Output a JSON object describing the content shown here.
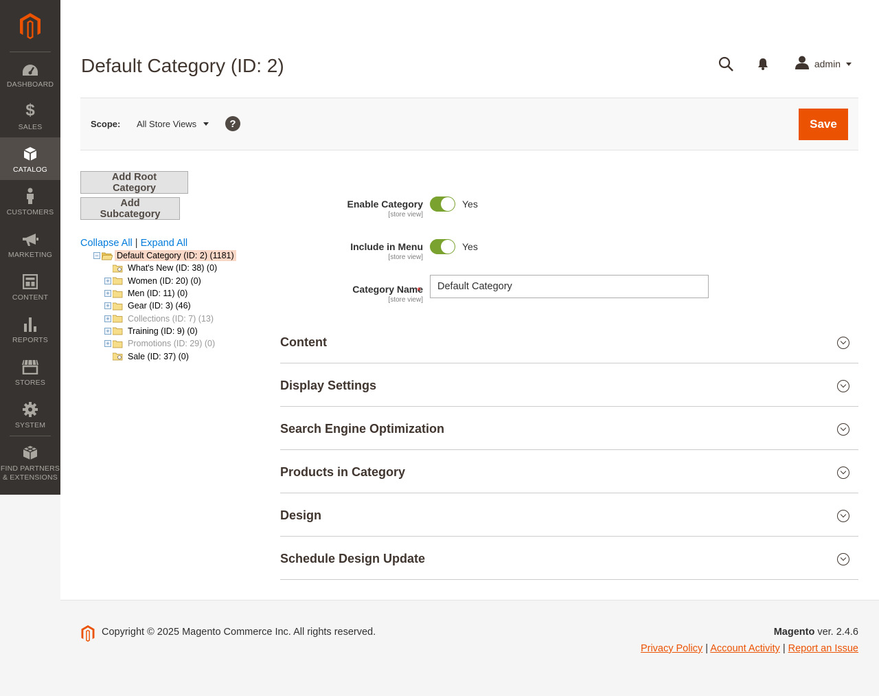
{
  "sidebar": {
    "items": [
      {
        "label": "DASHBOARD",
        "icon": "dashboard-icon"
      },
      {
        "label": "SALES",
        "icon": "dollar-icon"
      },
      {
        "label": "CATALOG",
        "icon": "box-icon",
        "active": true
      },
      {
        "label": "CUSTOMERS",
        "icon": "person-icon"
      },
      {
        "label": "MARKETING",
        "icon": "megaphone-icon"
      },
      {
        "label": "CONTENT",
        "icon": "layout-icon"
      },
      {
        "label": "REPORTS",
        "icon": "bar-chart-icon"
      },
      {
        "label": "STORES",
        "icon": "storefront-icon"
      },
      {
        "label": "SYSTEM",
        "icon": "gear-icon"
      },
      {
        "label": "FIND PARTNERS & EXTENSIONS",
        "icon": "cubes-icon"
      }
    ]
  },
  "header": {
    "title": "Default Category (ID: 2)",
    "user": "admin"
  },
  "scope": {
    "label": "Scope:",
    "value": "All Store Views",
    "help": "?"
  },
  "toolbar": {
    "save_label": "Save"
  },
  "tree": {
    "add_root_label": "Add Root Category",
    "add_sub_label": "Add Subcategory",
    "collapse_label": "Collapse All",
    "separator": "|",
    "expand_label": "Expand All",
    "root": "Default Category (ID: 2) (1181)",
    "children": [
      {
        "label": "What's New (ID: 38) (0)",
        "expandable": false,
        "disabled": false
      },
      {
        "label": "Women (ID: 20) (0)",
        "expandable": true,
        "disabled": false
      },
      {
        "label": "Men (ID: 11) (0)",
        "expandable": true,
        "disabled": false
      },
      {
        "label": "Gear (ID: 3) (46)",
        "expandable": true,
        "disabled": false
      },
      {
        "label": "Collections (ID: 7) (13)",
        "expandable": true,
        "disabled": true
      },
      {
        "label": "Training (ID: 9) (0)",
        "expandable": true,
        "disabled": false
      },
      {
        "label": "Promotions (ID: 29) (0)",
        "expandable": true,
        "disabled": true
      },
      {
        "label": "Sale (ID: 37) (0)",
        "expandable": false,
        "disabled": false
      }
    ]
  },
  "form": {
    "enable_category": {
      "label": "Enable Category",
      "scope": "[store view]",
      "value": "Yes"
    },
    "include_in_menu": {
      "label": "Include in Menu",
      "scope": "[store view]",
      "value": "Yes"
    },
    "category_name": {
      "label": "Category Name",
      "scope": "[store view]",
      "required": "*",
      "value": "Default Category"
    }
  },
  "sections": [
    "Content",
    "Display Settings",
    "Search Engine Optimization",
    "Products in Category",
    "Design",
    "Schedule Design Update"
  ],
  "footer": {
    "copyright": "Copyright © 2025 Magento Commerce Inc. All rights reserved.",
    "brand": "Magento",
    "version": " ver. 2.4.6",
    "links": [
      "Privacy Policy",
      "Account Activity",
      "Report an Issue"
    ],
    "link_separator": "|"
  },
  "colors": {
    "accent": "#eb5202",
    "sidebar": "#373330",
    "toggle_on": "#79a22e",
    "link": "#007bdb"
  }
}
